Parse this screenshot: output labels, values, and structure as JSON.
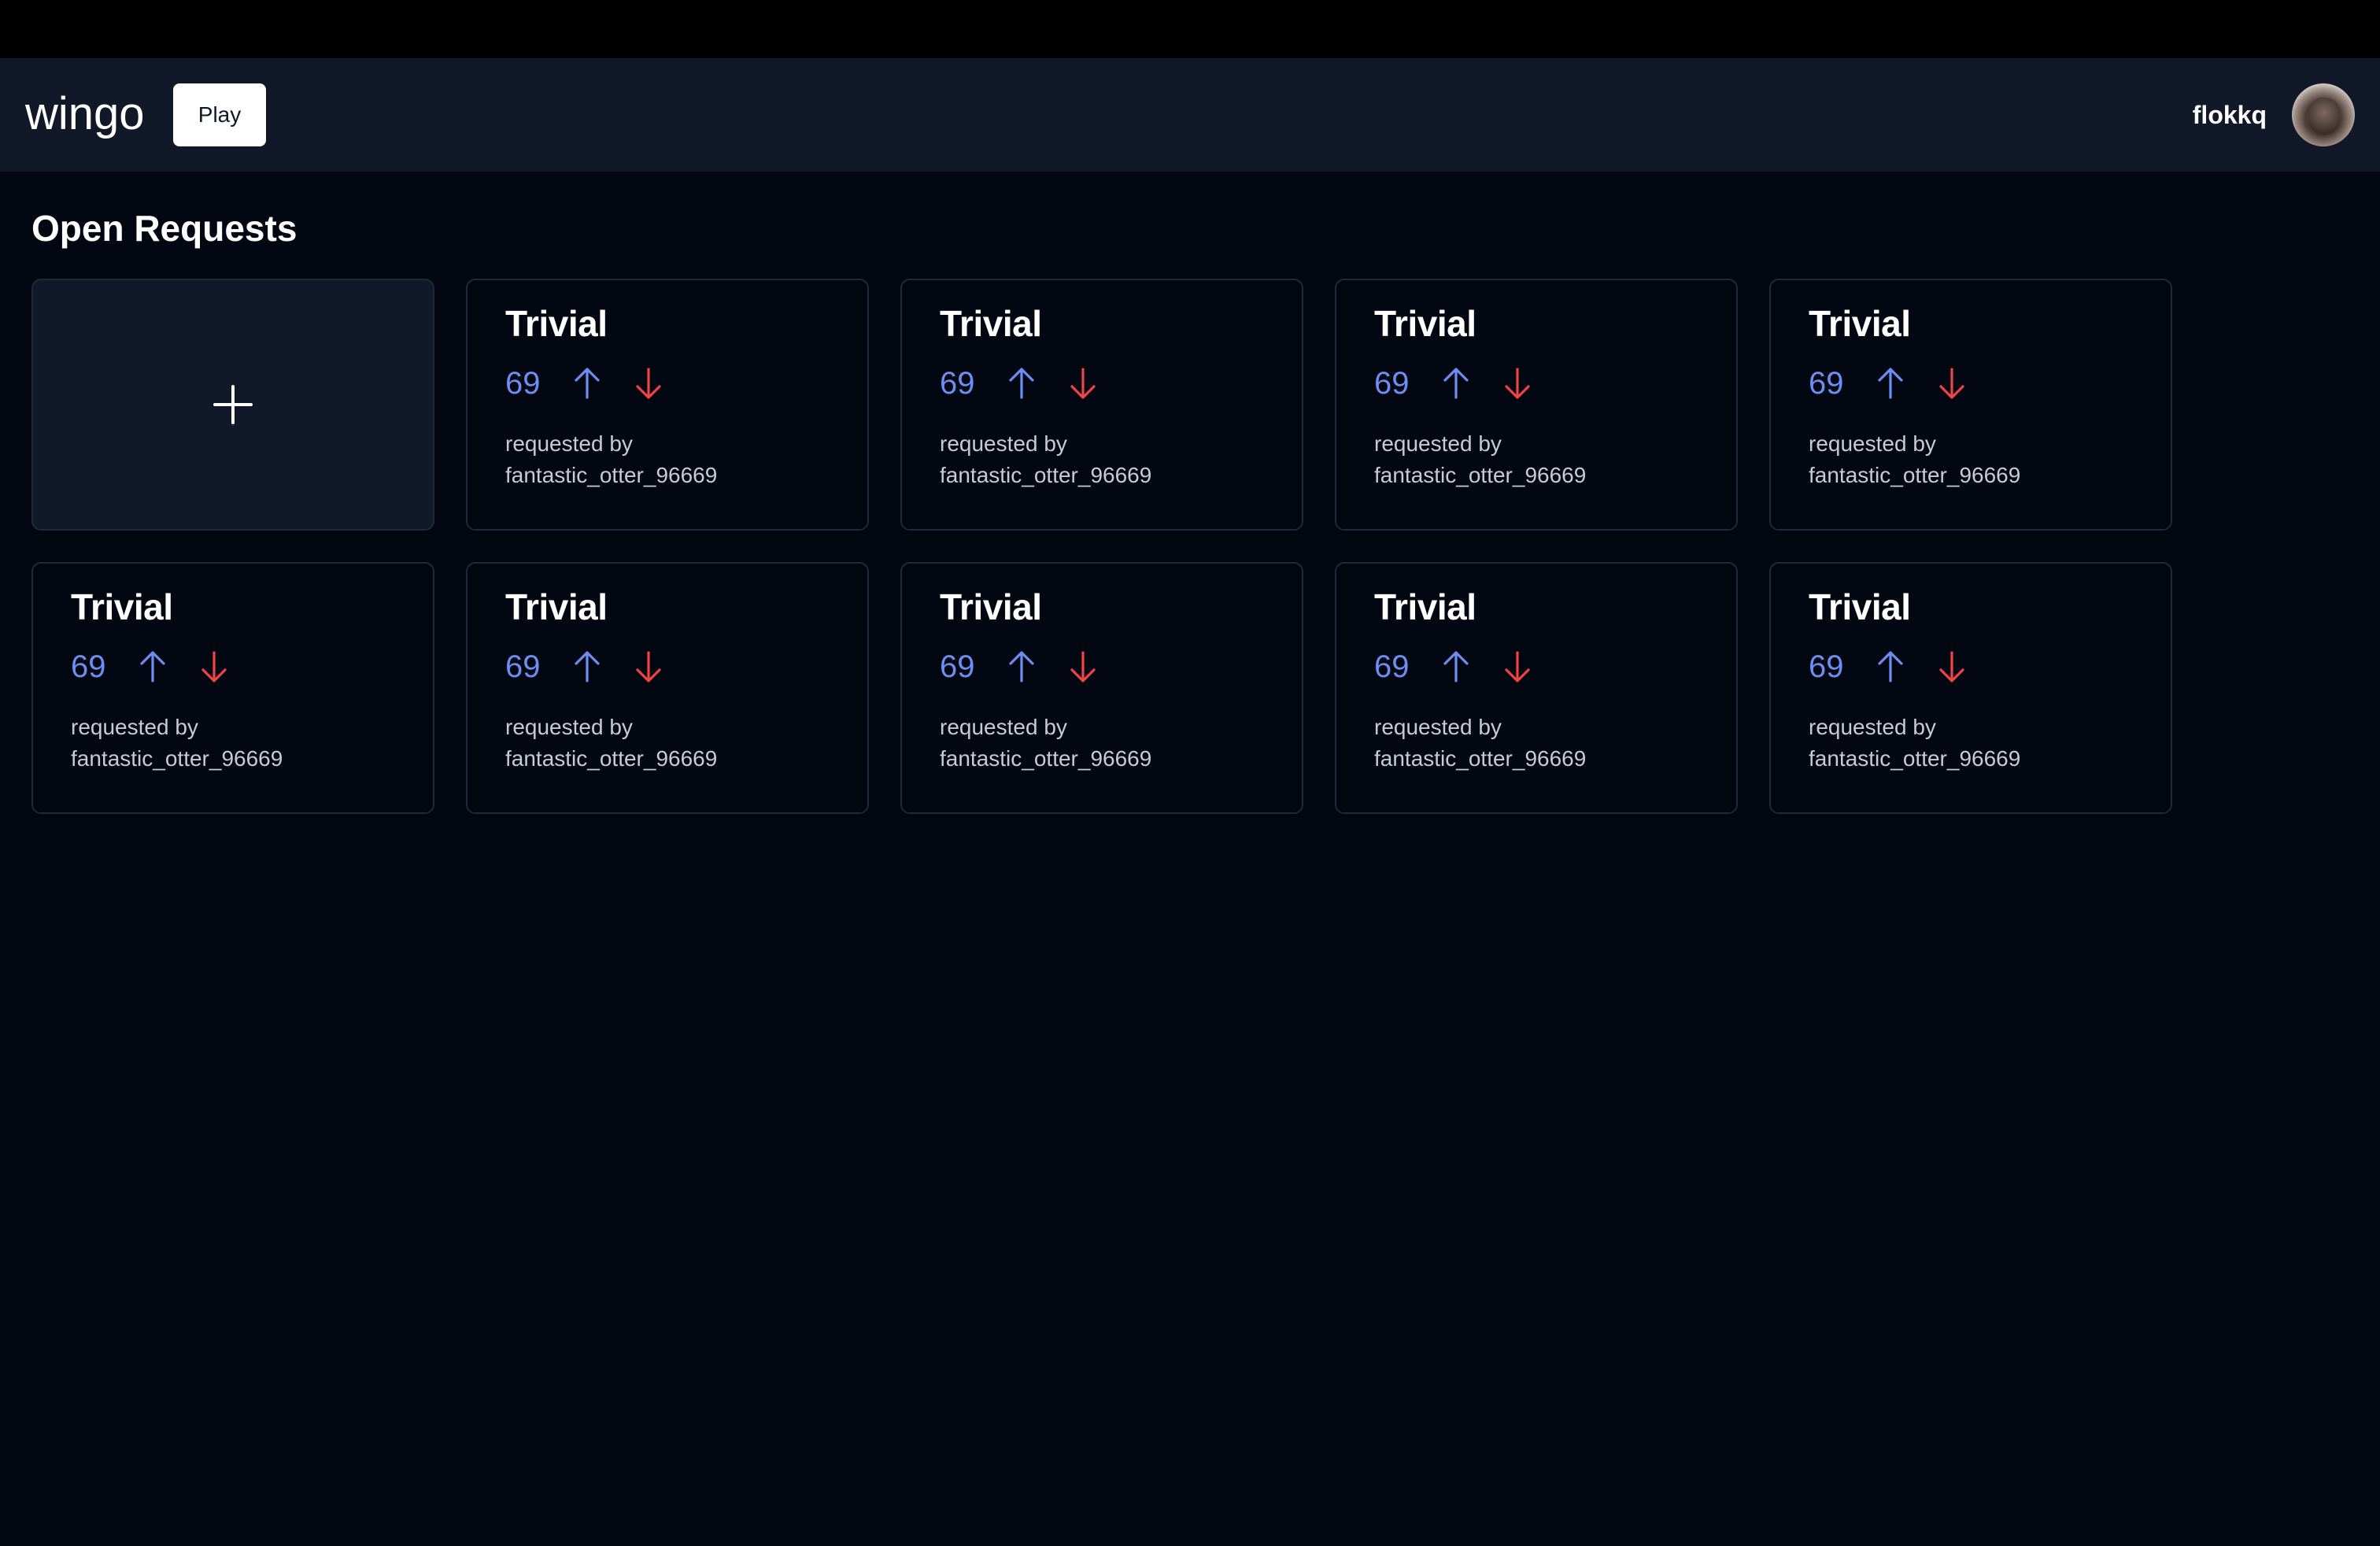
{
  "header": {
    "logo": "wingo",
    "play_label": "Play",
    "username": "flokkq"
  },
  "main": {
    "title": "Open Requests",
    "add_icon": "plus-icon",
    "colors": {
      "score": "#6d8df0",
      "upvote": "#6d8df0",
      "downvote": "#ef4444"
    },
    "requests": [
      {
        "title": "Trivial",
        "score": "69",
        "requested_label": "requested by",
        "requester": "fantastic_otter_96669"
      },
      {
        "title": "Trivial",
        "score": "69",
        "requested_label": "requested by",
        "requester": "fantastic_otter_96669"
      },
      {
        "title": "Trivial",
        "score": "69",
        "requested_label": "requested by",
        "requester": "fantastic_otter_96669"
      },
      {
        "title": "Trivial",
        "score": "69",
        "requested_label": "requested by",
        "requester": "fantastic_otter_96669"
      },
      {
        "title": "Trivial",
        "score": "69",
        "requested_label": "requested by",
        "requester": "fantastic_otter_96669"
      },
      {
        "title": "Trivial",
        "score": "69",
        "requested_label": "requested by",
        "requester": "fantastic_otter_96669"
      },
      {
        "title": "Trivial",
        "score": "69",
        "requested_label": "requested by",
        "requester": "fantastic_otter_96669"
      },
      {
        "title": "Trivial",
        "score": "69",
        "requested_label": "requested by",
        "requester": "fantastic_otter_96669"
      },
      {
        "title": "Trivial",
        "score": "69",
        "requested_label": "requested by",
        "requester": "fantastic_otter_96669"
      }
    ]
  }
}
